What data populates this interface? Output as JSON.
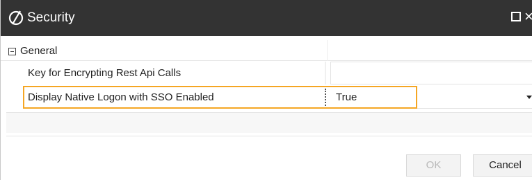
{
  "window": {
    "title": "Security",
    "icon": "security-slash-circle-icon",
    "maximize_icon": "maximize-icon",
    "close_icon": "close-icon",
    "close_glyph": "×"
  },
  "grid": {
    "group": {
      "label": "General",
      "toggle_icon": "collapse-minus-icon",
      "expanded": true
    },
    "properties": [
      {
        "name": "Key for Encrypting Rest Api Calls",
        "value": ""
      },
      {
        "name": "Display Native Logon with SSO Enabled",
        "value": "True",
        "editor": "dropdown",
        "focused": true
      }
    ]
  },
  "footer": {
    "ok_label": "OK",
    "ok_enabled": false,
    "cancel_label": "Cancel"
  },
  "colors": {
    "titlebar": "#333333",
    "focus_border": "#f5a623",
    "disabled_text": "#b8b8b8"
  }
}
